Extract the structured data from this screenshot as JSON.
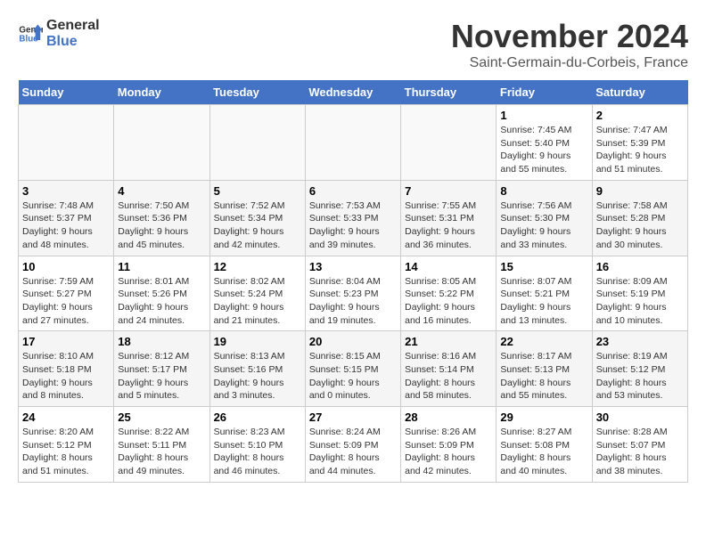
{
  "header": {
    "logo_line1": "General",
    "logo_line2": "Blue",
    "month": "November 2024",
    "location": "Saint-Germain-du-Corbeis, France"
  },
  "weekdays": [
    "Sunday",
    "Monday",
    "Tuesday",
    "Wednesday",
    "Thursday",
    "Friday",
    "Saturday"
  ],
  "weeks": [
    [
      {
        "day": "",
        "info": ""
      },
      {
        "day": "",
        "info": ""
      },
      {
        "day": "",
        "info": ""
      },
      {
        "day": "",
        "info": ""
      },
      {
        "day": "",
        "info": ""
      },
      {
        "day": "1",
        "info": "Sunrise: 7:45 AM\nSunset: 5:40 PM\nDaylight: 9 hours and 55 minutes."
      },
      {
        "day": "2",
        "info": "Sunrise: 7:47 AM\nSunset: 5:39 PM\nDaylight: 9 hours and 51 minutes."
      }
    ],
    [
      {
        "day": "3",
        "info": "Sunrise: 7:48 AM\nSunset: 5:37 PM\nDaylight: 9 hours and 48 minutes."
      },
      {
        "day": "4",
        "info": "Sunrise: 7:50 AM\nSunset: 5:36 PM\nDaylight: 9 hours and 45 minutes."
      },
      {
        "day": "5",
        "info": "Sunrise: 7:52 AM\nSunset: 5:34 PM\nDaylight: 9 hours and 42 minutes."
      },
      {
        "day": "6",
        "info": "Sunrise: 7:53 AM\nSunset: 5:33 PM\nDaylight: 9 hours and 39 minutes."
      },
      {
        "day": "7",
        "info": "Sunrise: 7:55 AM\nSunset: 5:31 PM\nDaylight: 9 hours and 36 minutes."
      },
      {
        "day": "8",
        "info": "Sunrise: 7:56 AM\nSunset: 5:30 PM\nDaylight: 9 hours and 33 minutes."
      },
      {
        "day": "9",
        "info": "Sunrise: 7:58 AM\nSunset: 5:28 PM\nDaylight: 9 hours and 30 minutes."
      }
    ],
    [
      {
        "day": "10",
        "info": "Sunrise: 7:59 AM\nSunset: 5:27 PM\nDaylight: 9 hours and 27 minutes."
      },
      {
        "day": "11",
        "info": "Sunrise: 8:01 AM\nSunset: 5:26 PM\nDaylight: 9 hours and 24 minutes."
      },
      {
        "day": "12",
        "info": "Sunrise: 8:02 AM\nSunset: 5:24 PM\nDaylight: 9 hours and 21 minutes."
      },
      {
        "day": "13",
        "info": "Sunrise: 8:04 AM\nSunset: 5:23 PM\nDaylight: 9 hours and 19 minutes."
      },
      {
        "day": "14",
        "info": "Sunrise: 8:05 AM\nSunset: 5:22 PM\nDaylight: 9 hours and 16 minutes."
      },
      {
        "day": "15",
        "info": "Sunrise: 8:07 AM\nSunset: 5:21 PM\nDaylight: 9 hours and 13 minutes."
      },
      {
        "day": "16",
        "info": "Sunrise: 8:09 AM\nSunset: 5:19 PM\nDaylight: 9 hours and 10 minutes."
      }
    ],
    [
      {
        "day": "17",
        "info": "Sunrise: 8:10 AM\nSunset: 5:18 PM\nDaylight: 9 hours and 8 minutes."
      },
      {
        "day": "18",
        "info": "Sunrise: 8:12 AM\nSunset: 5:17 PM\nDaylight: 9 hours and 5 minutes."
      },
      {
        "day": "19",
        "info": "Sunrise: 8:13 AM\nSunset: 5:16 PM\nDaylight: 9 hours and 3 minutes."
      },
      {
        "day": "20",
        "info": "Sunrise: 8:15 AM\nSunset: 5:15 PM\nDaylight: 9 hours and 0 minutes."
      },
      {
        "day": "21",
        "info": "Sunrise: 8:16 AM\nSunset: 5:14 PM\nDaylight: 8 hours and 58 minutes."
      },
      {
        "day": "22",
        "info": "Sunrise: 8:17 AM\nSunset: 5:13 PM\nDaylight: 8 hours and 55 minutes."
      },
      {
        "day": "23",
        "info": "Sunrise: 8:19 AM\nSunset: 5:12 PM\nDaylight: 8 hours and 53 minutes."
      }
    ],
    [
      {
        "day": "24",
        "info": "Sunrise: 8:20 AM\nSunset: 5:12 PM\nDaylight: 8 hours and 51 minutes."
      },
      {
        "day": "25",
        "info": "Sunrise: 8:22 AM\nSunset: 5:11 PM\nDaylight: 8 hours and 49 minutes."
      },
      {
        "day": "26",
        "info": "Sunrise: 8:23 AM\nSunset: 5:10 PM\nDaylight: 8 hours and 46 minutes."
      },
      {
        "day": "27",
        "info": "Sunrise: 8:24 AM\nSunset: 5:09 PM\nDaylight: 8 hours and 44 minutes."
      },
      {
        "day": "28",
        "info": "Sunrise: 8:26 AM\nSunset: 5:09 PM\nDaylight: 8 hours and 42 minutes."
      },
      {
        "day": "29",
        "info": "Sunrise: 8:27 AM\nSunset: 5:08 PM\nDaylight: 8 hours and 40 minutes."
      },
      {
        "day": "30",
        "info": "Sunrise: 8:28 AM\nSunset: 5:07 PM\nDaylight: 8 hours and 38 minutes."
      }
    ]
  ]
}
